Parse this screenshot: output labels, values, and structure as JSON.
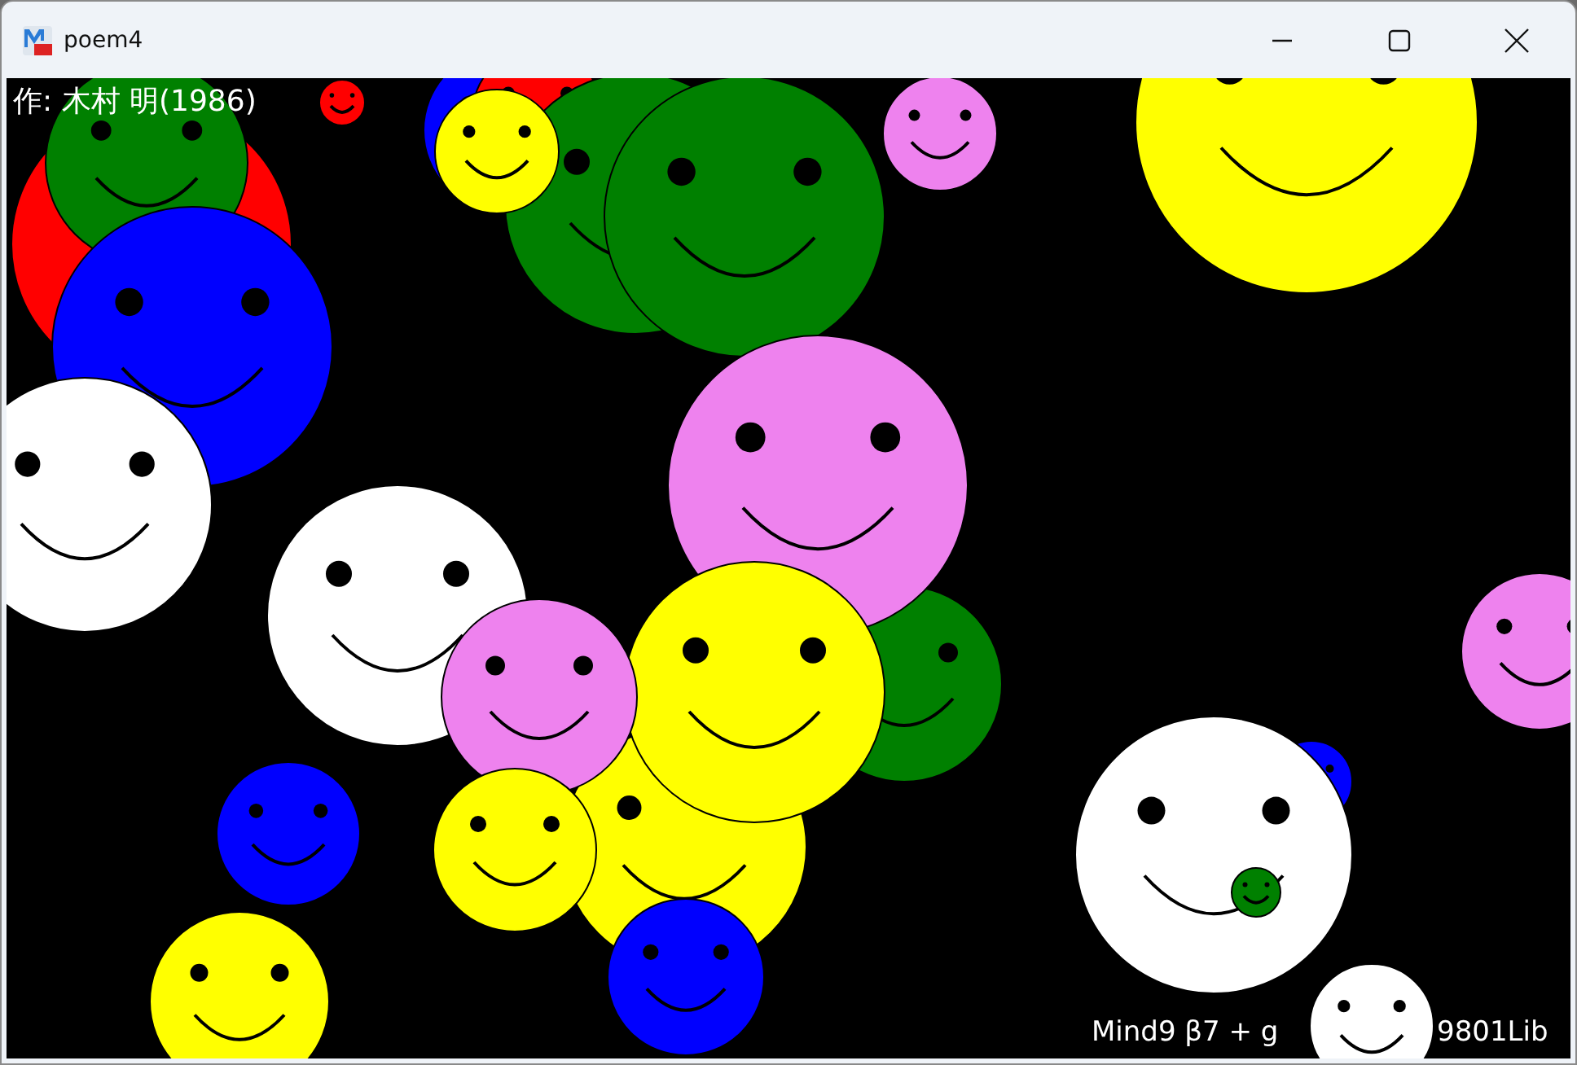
{
  "window": {
    "title": "poem4"
  },
  "canvas": {
    "author_caption": "作: 木村 明(1986)",
    "credit_left": "Mind9 β7 + g",
    "credit_right": "9801Lib"
  }
}
